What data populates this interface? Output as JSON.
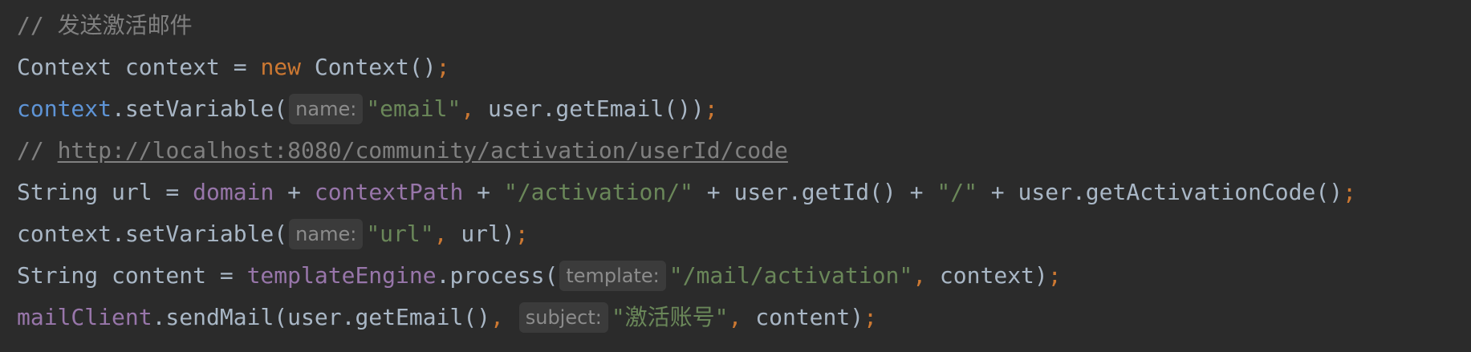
{
  "code": {
    "lines": [
      {
        "tokens": [
          {
            "text": "// 发送激活邮件",
            "type": "cm"
          }
        ]
      },
      {
        "tokens": [
          {
            "text": "Context context = ",
            "type": "t"
          },
          {
            "text": "new",
            "type": "kw"
          },
          {
            "text": " Context()",
            "type": "t"
          },
          {
            "text": ";",
            "type": "semi"
          }
        ]
      },
      {
        "tokens": [
          {
            "text": "context",
            "type": "lvar"
          },
          {
            "text": ".setVariable(",
            "type": "t"
          },
          {
            "text": "name:",
            "type": "hint"
          },
          {
            "text": "\"email\"",
            "type": "str"
          },
          {
            "text": ",",
            "type": "kw"
          },
          {
            "text": " user.getEmail())",
            "type": "t"
          },
          {
            "text": ";",
            "type": "semi"
          }
        ]
      },
      {
        "tokens": [
          {
            "text": "// ",
            "type": "cm"
          },
          {
            "text": "http://localhost:8080/community/activation/userId/code",
            "type": "link"
          }
        ]
      },
      {
        "tokens": [
          {
            "text": "String url = ",
            "type": "t"
          },
          {
            "text": "domain",
            "type": "fld"
          },
          {
            "text": " + ",
            "type": "t"
          },
          {
            "text": "contextPath",
            "type": "fld"
          },
          {
            "text": " + ",
            "type": "t"
          },
          {
            "text": "\"/activation/\"",
            "type": "str"
          },
          {
            "text": " + user.getId() + ",
            "type": "t"
          },
          {
            "text": "\"/\"",
            "type": "str"
          },
          {
            "text": " + user.getActivationCode()",
            "type": "t"
          },
          {
            "text": ";",
            "type": "semi"
          }
        ]
      },
      {
        "tokens": [
          {
            "text": "context.setVariable(",
            "type": "t"
          },
          {
            "text": "name:",
            "type": "hint"
          },
          {
            "text": "\"url\"",
            "type": "str"
          },
          {
            "text": ",",
            "type": "kw"
          },
          {
            "text": " url)",
            "type": "t"
          },
          {
            "text": ";",
            "type": "semi"
          }
        ]
      },
      {
        "tokens": [
          {
            "text": "String content = ",
            "type": "t"
          },
          {
            "text": "templateEngine",
            "type": "fld"
          },
          {
            "text": ".process(",
            "type": "t"
          },
          {
            "text": "template:",
            "type": "hint"
          },
          {
            "text": "\"/mail/activation\"",
            "type": "str"
          },
          {
            "text": ",",
            "type": "kw"
          },
          {
            "text": " context)",
            "type": "t"
          },
          {
            "text": ";",
            "type": "semi"
          }
        ]
      },
      {
        "tokens": [
          {
            "text": "mailClient",
            "type": "fld"
          },
          {
            "text": ".sendMail(user.getEmail()",
            "type": "t"
          },
          {
            "text": ",",
            "type": "kw"
          },
          {
            "text": " ",
            "type": "t"
          },
          {
            "text": "subject:",
            "type": "hint"
          },
          {
            "text": "\"激活账号\"",
            "type": "str"
          },
          {
            "text": ",",
            "type": "kw"
          },
          {
            "text": " content)",
            "type": "t"
          },
          {
            "text": ";",
            "type": "semi"
          }
        ]
      }
    ]
  },
  "colors": {
    "background": "#2b2b2b",
    "text": "#a9b7c6",
    "comment": "#808080",
    "keyword": "#cc7832",
    "string": "#6a8759",
    "field": "#9876aa",
    "local_variable": "#5e94d6",
    "inlay_hint_bg": "#3b3b3b",
    "inlay_hint_text": "#8c8c8c"
  }
}
